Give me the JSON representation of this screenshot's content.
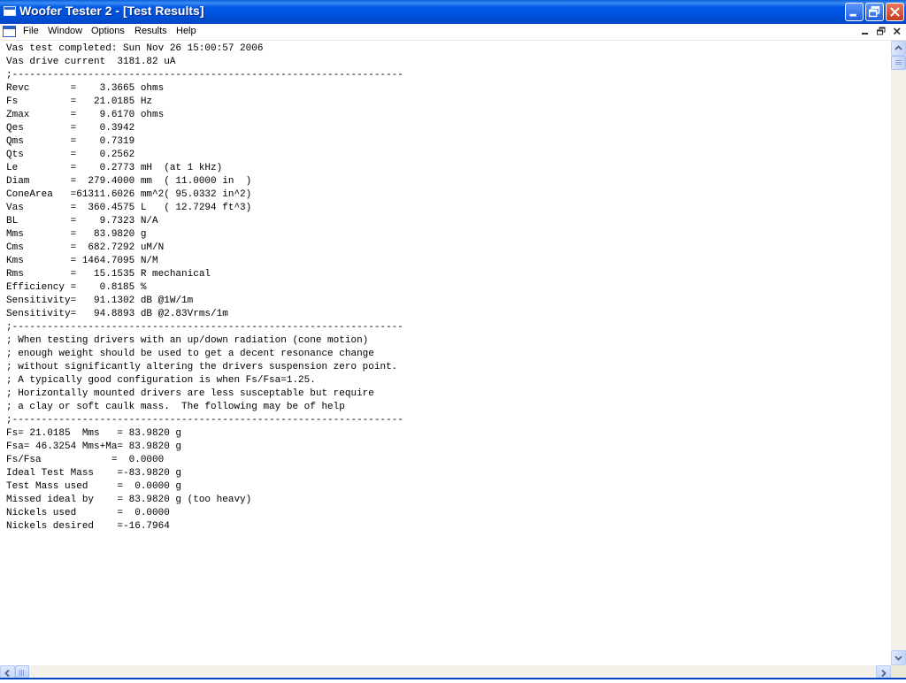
{
  "window": {
    "title": "Woofer Tester 2 - [Test Results]"
  },
  "menu": {
    "items": [
      "File",
      "Window",
      "Options",
      "Results",
      "Help"
    ]
  },
  "report": {
    "lines": [
      "Vas test completed: Sun Nov 26 15:00:57 2006",
      "Vas drive current  3181.82 uA",
      ";-------------------------------------------------------------------",
      "Revc       =    3.3665 ohms",
      "Fs         =   21.0185 Hz",
      "Zmax       =    9.6170 ohms",
      "Qes        =    0.3942",
      "Qms        =    0.7319",
      "Qts        =    0.2562",
      "Le         =    0.2773 mH  (at 1 kHz)",
      "Diam       =  279.4000 mm  ( 11.0000 in  )",
      "ConeArea   =61311.6026 mm^2( 95.0332 in^2)",
      "Vas        =  360.4575 L   ( 12.7294 ft^3)",
      "BL         =    9.7323 N/A",
      "Mms        =   83.9820 g",
      "Cms        =  682.7292 uM/N",
      "Kms        = 1464.7095 N/M",
      "Rms        =   15.1535 R mechanical",
      "Efficiency =    0.8185 %",
      "Sensitivity=   91.1302 dB @1W/1m",
      "Sensitivity=   94.8893 dB @2.83Vrms/1m",
      ";-------------------------------------------------------------------",
      "; When testing drivers with an up/down radiation (cone motion)",
      "; enough weight should be used to get a decent resonance change",
      "; without significantly altering the drivers suspension zero point.",
      "; A typically good configuration is when Fs/Fsa=1.25.",
      "; Horizontally mounted drivers are less susceptable but require",
      "; a clay or soft caulk mass.  The following may be of help",
      ";-------------------------------------------------------------------",
      "Fs= 21.0185  Mms   = 83.9820 g",
      "Fsa= 46.3254 Mms+Ma= 83.9820 g",
      "Fs/Fsa            =  0.0000",
      "Ideal Test Mass    =-83.9820 g",
      "Test Mass used     =  0.0000 g",
      "Missed ideal by    = 83.9820 g (too heavy)",
      "Nickels used       =  0.0000",
      "Nickels desired    =-16.7964"
    ]
  },
  "colors": {
    "titlebar": "#0058e6",
    "close_button": "#c23d1e",
    "scrollbar": "#c3d4f7"
  },
  "icons": {
    "app": "window-app-icon",
    "mdi": "mdi-document-icon"
  }
}
